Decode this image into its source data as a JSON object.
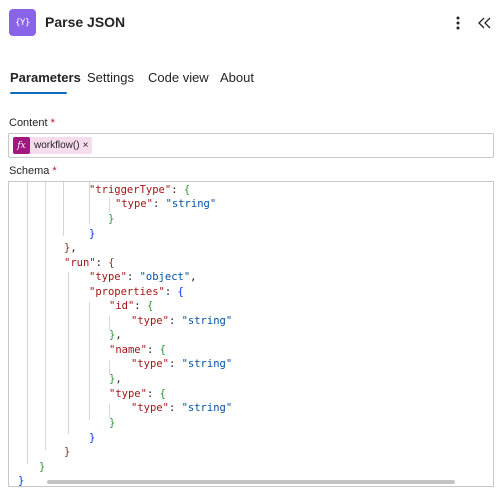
{
  "header": {
    "app_icon_glyph": "{Y}",
    "title": "Parse JSON",
    "more_icon": "more-vertical-icon",
    "collapse_icon": "double-chevron-left-icon"
  },
  "tabs": [
    {
      "label": "Parameters",
      "active": true
    },
    {
      "label": "Settings",
      "active": false
    },
    {
      "label": "Code view",
      "active": false
    },
    {
      "label": "About",
      "active": false
    }
  ],
  "content": {
    "label": "Content",
    "required_mark": "*",
    "token": {
      "icon_glyph": "fx",
      "text": "workflow()",
      "close": "×"
    }
  },
  "schema": {
    "label": "Schema",
    "required_mark": "*",
    "lines": [
      "\"triggerType\": {",
      "\"type\": \"string\"",
      "}",
      "}",
      "},",
      "\"run\": {",
      "\"type\": \"object\",",
      "\"properties\": {",
      "\"id\": {",
      "\"type\": \"string\"",
      "},",
      "\"name\": {",
      "\"type\": \"string\"",
      "},",
      "\"type\": {",
      "\"type\": \"string\"",
      "}",
      "}",
      "}",
      "}",
      "}"
    ]
  },
  "colors": {
    "accent": "#0f6cbd",
    "app_icon_bg": "#8a64e8",
    "token_bg": "#f7dcee",
    "token_icon_bg": "#a4177f",
    "json_key": "#a31515",
    "json_string": "#0451a5"
  }
}
